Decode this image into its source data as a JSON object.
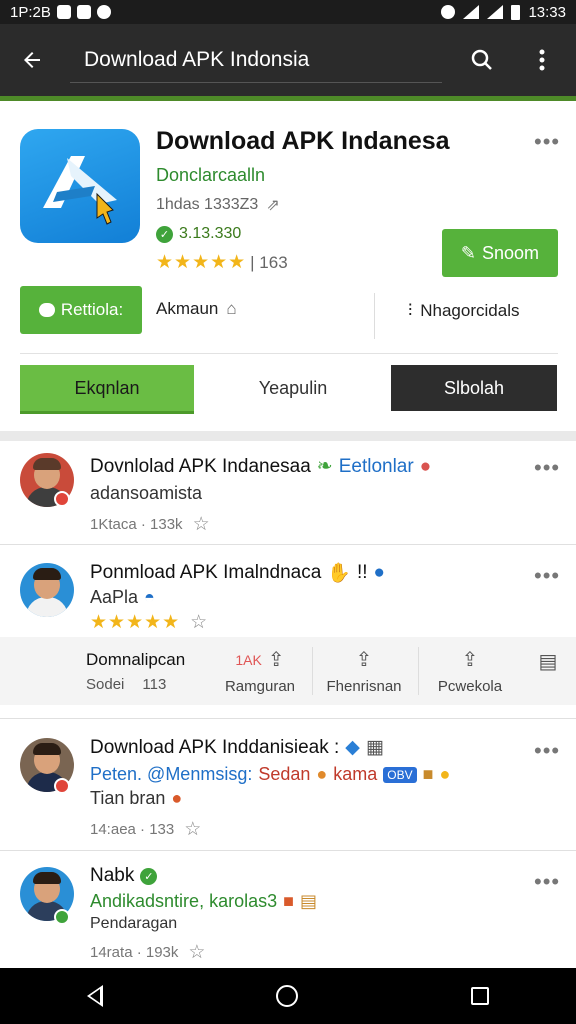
{
  "status_bar": {
    "time_left": "1P:2B",
    "time_right": "13:33"
  },
  "toolbar": {
    "search_text": "Download APK Indonsia",
    "back_icon": "back-arrow-icon",
    "search_icon": "search-icon",
    "menu_icon": "more-vert-icon"
  },
  "app": {
    "title": "Download APK Indanesa",
    "developer": "Donclarcaalln",
    "meta": "1hdas 1333Z3",
    "verified_count": "3.13.330",
    "rating_stars": "★★★★★",
    "rating_text": "| 163",
    "install_label": "Snoom",
    "brand_color": "#56b23b"
  },
  "actions": {
    "primary_label": "Rettiola:",
    "middle_label": "Akmaun",
    "right_label": "Nhagorcidals"
  },
  "tabs": [
    {
      "label": "Ekqnlan"
    },
    {
      "label": "Yeapulin"
    },
    {
      "label": "Slbolah"
    }
  ],
  "posts": [
    {
      "title": "Dovnlolad APK Indanesaa",
      "title_tag": "Eetlonlar",
      "subtitle": "adansoamista",
      "meta": "1Ktaca · 133k"
    },
    {
      "title": "Ponmload APK Imalndnaca",
      "title_tag": "!!",
      "subtitle": "AaPla",
      "stars": "★★★★★",
      "share_label": "Domnalipcan",
      "share_badge": "1AK",
      "share_count_label": "Sodei",
      "share_count": "113",
      "share_items": [
        "Ramguran",
        "Fhenrisnan",
        "Pcwekola"
      ]
    },
    {
      "title": "Download APK Inddanisieak :",
      "subtitle_a": "Peten. @Menmsisg:",
      "subtitle_b": "Sedan",
      "subtitle_c": "kama",
      "subtitle_tag": "OBV",
      "line3": "Tian bran",
      "meta": "14:aea · 133"
    },
    {
      "title": "Nabk",
      "subtitle": "Andikadsntire, karolas3",
      "line3": "Pendaragan",
      "meta": "14rata · 193k"
    }
  ]
}
